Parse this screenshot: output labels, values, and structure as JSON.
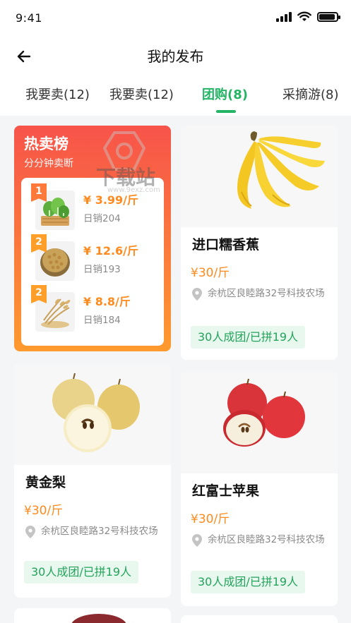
{
  "status_bar": {
    "time": "9:41"
  },
  "header": {
    "title": "我的发布",
    "back_icon": "arrow-left-icon"
  },
  "tabs": [
    {
      "label": "我要卖(12)",
      "active": false
    },
    {
      "label": "我要卖(12)",
      "active": false
    },
    {
      "label": "团购(8)",
      "active": true
    },
    {
      "label": "采摘游(8)",
      "active": false
    }
  ],
  "hot_list": {
    "title": "热卖榜",
    "subtitle": "分分钟卖断",
    "items": [
      {
        "rank": "1",
        "price": "¥ 3.99/斤",
        "sales": "日销204",
        "image": "greens-icon"
      },
      {
        "rank": "2",
        "price": "¥ 12.6/斤",
        "sales": "日销193",
        "image": "soybean-icon"
      },
      {
        "rank": "2",
        "price": "¥ 8.8/斤",
        "sales": "日销184",
        "image": "wheat-icon"
      }
    ]
  },
  "watermark": {
    "text": "下载站",
    "url": "www.9exz.com"
  },
  "products": [
    {
      "name": "进口糯香蕉",
      "price": "¥30/斤",
      "address": "余杭区良睦路32号科技农场",
      "tag": "30人成团/已拼19人",
      "image": "banana-icon"
    },
    {
      "name": "黄金梨",
      "price": "¥30/斤",
      "address": "余杭区良睦路32号科技农场",
      "tag": "30人成团/已拼19人",
      "image": "pear-icon"
    },
    {
      "name": "红富士苹果",
      "price": "¥30/斤",
      "address": "余杭区良睦路32号科技农场",
      "tag": "30人成团/已拼19人",
      "image": "apple-icon"
    }
  ],
  "colors": {
    "accent": "#23b465",
    "price": "#ff8a1e",
    "hot_gradient_top": "#f7534a",
    "hot_gradient_bottom": "#fe9a2e"
  }
}
